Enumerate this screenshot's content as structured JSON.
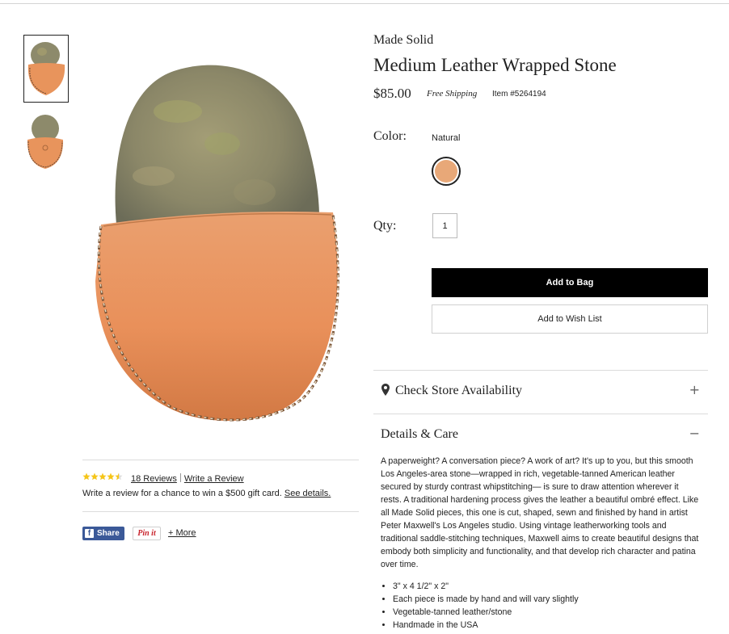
{
  "product": {
    "brand": "Made Solid",
    "title": "Medium Leather Wrapped Stone",
    "price": "$85.00",
    "shipping": "Free Shipping",
    "item_number": "Item #5264194"
  },
  "options": {
    "color_label": "Color:",
    "color_value": "Natural",
    "swatch_color": "#e8a878",
    "qty_label": "Qty:",
    "qty_value": "1"
  },
  "actions": {
    "add_to_bag": "Add to Bag",
    "add_to_wish_list": "Add to Wish List"
  },
  "sections": {
    "store_availability": {
      "label": "Check Store Availability",
      "toggle": "+"
    },
    "details_care": {
      "label": "Details & Care",
      "toggle": "−"
    }
  },
  "details": {
    "description": "A paperweight? A conversation piece? A work of art? It's up to you, but this smooth Los Angeles-area stone—wrapped in rich, vegetable-tanned American leather secured by sturdy contrast whipstitching— is sure to draw attention wherever it rests. A traditional hardening process gives the leather a beautiful ombré effect. Like all Made Solid pieces, this one is cut, shaped, sewn and finished by hand in artist Peter Maxwell's Los Angeles studio. Using vintage leatherworking tools and traditional saddle-stitching techniques, Maxwell aims to create beautiful designs that embody both simplicity and functionality, and that develop rich character and patina over time.",
    "bullets": [
      "3\" x 4 1/2\" x 2\"",
      "Each piece is made by hand and will vary slightly",
      "Vegetable-tanned leather/stone",
      "Handmade in the USA"
    ]
  },
  "reviews": {
    "rating": 4.5,
    "star_color": "#f5c518",
    "count_label": "18 Reviews",
    "write_label": "Write a Review",
    "promo_text": "Write a review for a chance to win a $500 gift card.",
    "promo_link": "See details."
  },
  "social": {
    "share_label": "Share",
    "pinit_label": "Pin it",
    "more_label": "+ More"
  },
  "colors": {
    "leather": "#e9965f",
    "stone": "#8f8a6c",
    "facebook": "#3b5998"
  }
}
